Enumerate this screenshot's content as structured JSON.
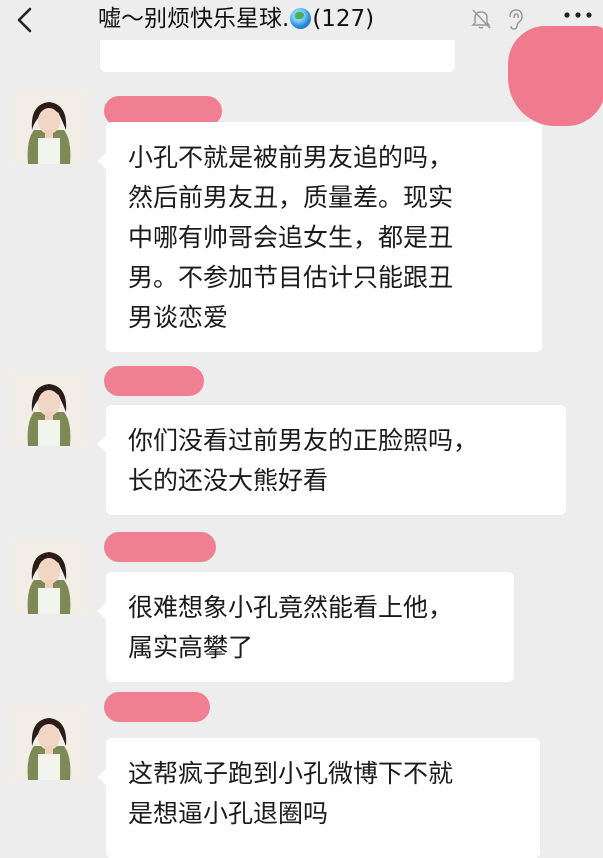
{
  "header": {
    "title_prefix": "嘘～别烦快乐星球.",
    "title_suffix": "(127)",
    "back_icon": "chevron-left-icon",
    "mute_icon": "bell-muted-icon",
    "ear_icon": "ear-icon",
    "more_icon": "more-dots-icon"
  },
  "messages": [
    {
      "text": "小孔不就是被前男友追的吗，\n然后前男友丑，质量差。现实\n中哪有帅哥会追女生，都是丑\n男。不参加节目估计只能跟丑\n男谈恋爱"
    },
    {
      "text": "你们没看过前男友的正脸照吗，\n长的还没大熊好看"
    },
    {
      "text": "很难想象小孔竟然能看上他，\n属实高攀了"
    },
    {
      "text": "这帮疯子跑到小孔微博下不就\n是想逼小孔退圈吗"
    }
  ],
  "colors": {
    "background": "#ededed",
    "bubble": "#ffffff",
    "redaction": "#f0758a"
  }
}
